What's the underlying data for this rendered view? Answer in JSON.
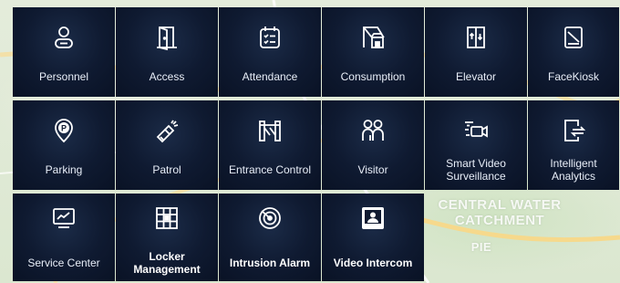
{
  "map": {
    "labels": [
      "CENTRAL WATER\nCATCHMENT",
      "PIE"
    ]
  },
  "tiles": [
    {
      "label": "Personnel",
      "icon": "person-icon"
    },
    {
      "label": "Access",
      "icon": "door-icon"
    },
    {
      "label": "Attendance",
      "icon": "calendar-check-icon"
    },
    {
      "label": "Consumption",
      "icon": "shop-icon"
    },
    {
      "label": "Elevator",
      "icon": "elevator-icon"
    },
    {
      "label": "FaceKiosk",
      "icon": "kiosk-icon"
    },
    {
      "label": "Parking",
      "icon": "parking-pin-icon"
    },
    {
      "label": "Patrol",
      "icon": "flashlight-icon"
    },
    {
      "label": "Entrance Control",
      "icon": "turnstile-icon"
    },
    {
      "label": "Visitor",
      "icon": "visitors-icon"
    },
    {
      "label": "Smart Video Surveillance",
      "icon": "camera-icon"
    },
    {
      "label": "Intelligent Analytics",
      "icon": "analytics-icon"
    },
    {
      "label": "Service Center",
      "icon": "monitor-chart-icon"
    },
    {
      "label": "Locker Management",
      "icon": "locker-icon"
    },
    {
      "label": "Intrusion Alarm",
      "icon": "radar-icon"
    },
    {
      "label": "Video Intercom",
      "icon": "intercom-icon"
    }
  ]
}
